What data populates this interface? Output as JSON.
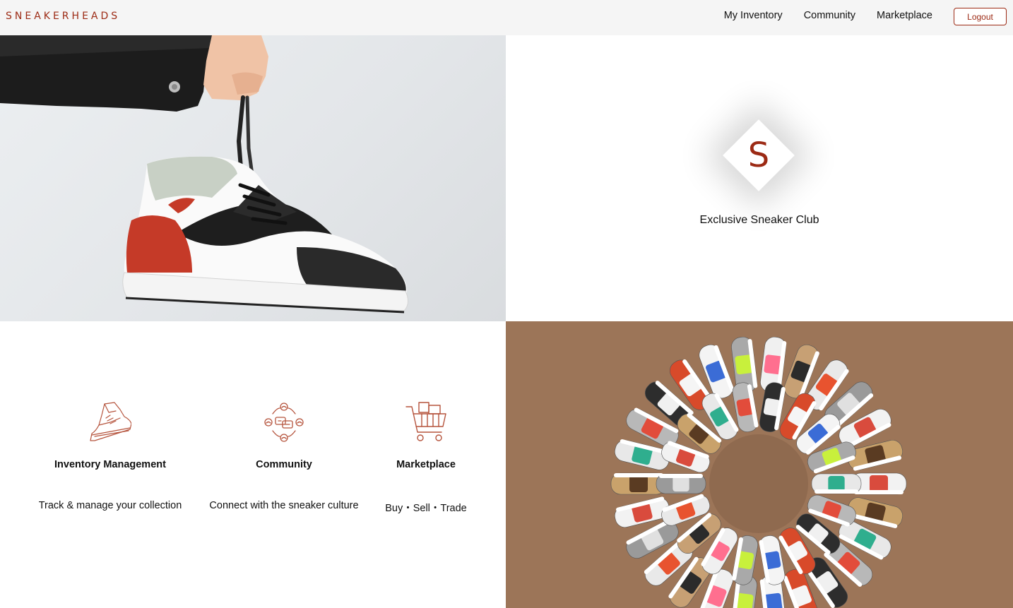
{
  "brand": "SNEAKERHEADS",
  "nav": {
    "links": [
      "My Inventory",
      "Community",
      "Marketplace"
    ],
    "logout_label": "Logout"
  },
  "hero": {
    "logo_letter": "S",
    "club_title": "Exclusive Sneaker Club"
  },
  "features": [
    {
      "icon": "sneaker-icon",
      "title": "Inventory Management",
      "desc": "Track & manage your collection"
    },
    {
      "icon": "community-icon",
      "title": "Community",
      "desc": "Connect with the sneaker culture"
    },
    {
      "icon": "cart-icon",
      "title": "Marketplace",
      "desc": "Buy・Sell・Trade"
    }
  ],
  "colors": {
    "accent": "#9c2a14",
    "nav_bg": "#f5f5f5",
    "floor_bg": "#9c7558"
  }
}
